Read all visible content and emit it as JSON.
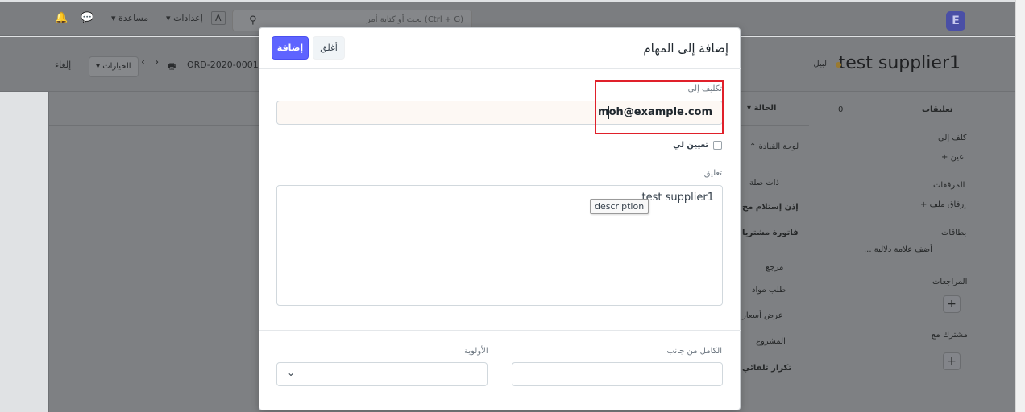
{
  "navbar": {
    "search_placeholder": "بحث أو كتابة أمر (Ctrl + G)",
    "settings_label": "إعدادات",
    "help_label": "مساعدة",
    "avatar_letter": "A",
    "logo_letter": "E"
  },
  "page_header": {
    "title": "test supplier1",
    "status": "لبيل",
    "doc_id": "ORD-2020-0001",
    "options_label": "الخيارات",
    "cancel_label": "إلغاء"
  },
  "sidebar": {
    "comments_label": "تعليقات",
    "comments_count": "0",
    "assigned_label": "كلف إلى",
    "assign_link": "+ عين",
    "attachments_label": "المرفقات",
    "attach_link": "+ إرفاق ملف",
    "tags_label": "بطاقات",
    "tags_link": "... أضف علامة دلالية",
    "reviews_label": "المراجعات",
    "shared_label": "مشترك مع"
  },
  "middle": {
    "status_label": "الحالة",
    "dashboard_label": "لوحة القيادة",
    "related_label": "ذات صلة",
    "receipt_label": "إذن إستلام مخ",
    "invoice_label": "فاتورة مشتريا",
    "reference_label": "مرجع",
    "material_request_label": "طلب مواد",
    "quotation_label": "عرض أسعار",
    "project_label": "المشروع",
    "auto_repeat_label": "تكرار تلقائي"
  },
  "modal": {
    "title": "إضافة إلى المهام",
    "add_button": "إضافة",
    "close_button": "أغلق",
    "assign_to_label": "تكليف إلى",
    "assign_to_value": "moh@example.com",
    "assign_me_label": "تعيين لي",
    "comment_label": "تعليق",
    "comment_value": "test supplier1",
    "tooltip": "description",
    "complete_by_label": "الكامل من جانب",
    "priority_label": "الأولوية"
  }
}
